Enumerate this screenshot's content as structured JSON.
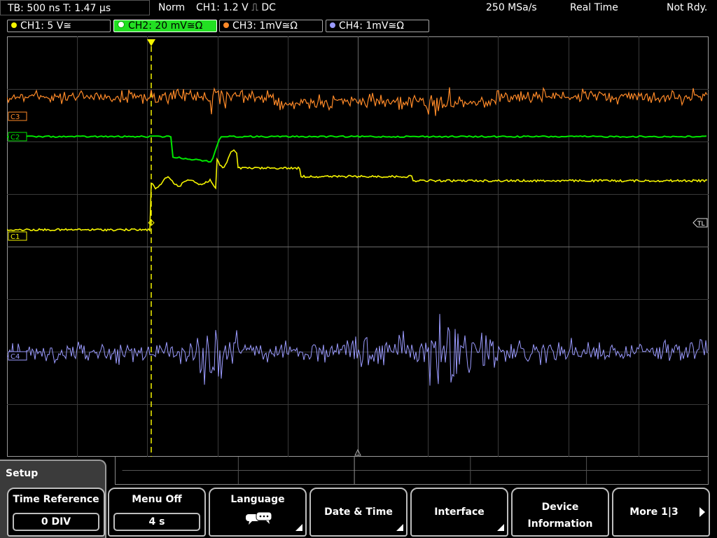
{
  "status": {
    "timebase": "TB: 500 ns   T: 1.47 µs",
    "trigger_mode": "Norm",
    "trigger_info": "CH1: 1.2 V ⎍ DC",
    "sample_rate": "250 MSa/s",
    "acq_mode": "Real Time",
    "state": "Not Rdy."
  },
  "channels": [
    {
      "label": "CH1: 5 V≅",
      "color": "#f4f400"
    },
    {
      "label": "CH2: 20 mV≅Ω",
      "color": "#00e600"
    },
    {
      "label": "CH3: 1mV≅Ω",
      "color": "#ff8a28"
    },
    {
      "label": "CH4: 1mV≅Ω",
      "color": "#9b9bff"
    }
  ],
  "markers": {
    "c1": "C1",
    "c2": "C2",
    "c3": "C3",
    "c4": "C4",
    "trigger_level": "TL"
  },
  "menu": {
    "title": "Setup",
    "softkeys": [
      {
        "label": "Time Reference",
        "value": "0 DIV"
      },
      {
        "label": "Menu Off",
        "value": "4 s"
      },
      {
        "label": "Language",
        "icon": "speech-bubbles-icon"
      },
      {
        "label": "Date & Time"
      },
      {
        "label": "Interface"
      },
      {
        "label_line1": "Device",
        "label_line2": "Information"
      },
      {
        "label": "More 1|3"
      }
    ]
  }
}
